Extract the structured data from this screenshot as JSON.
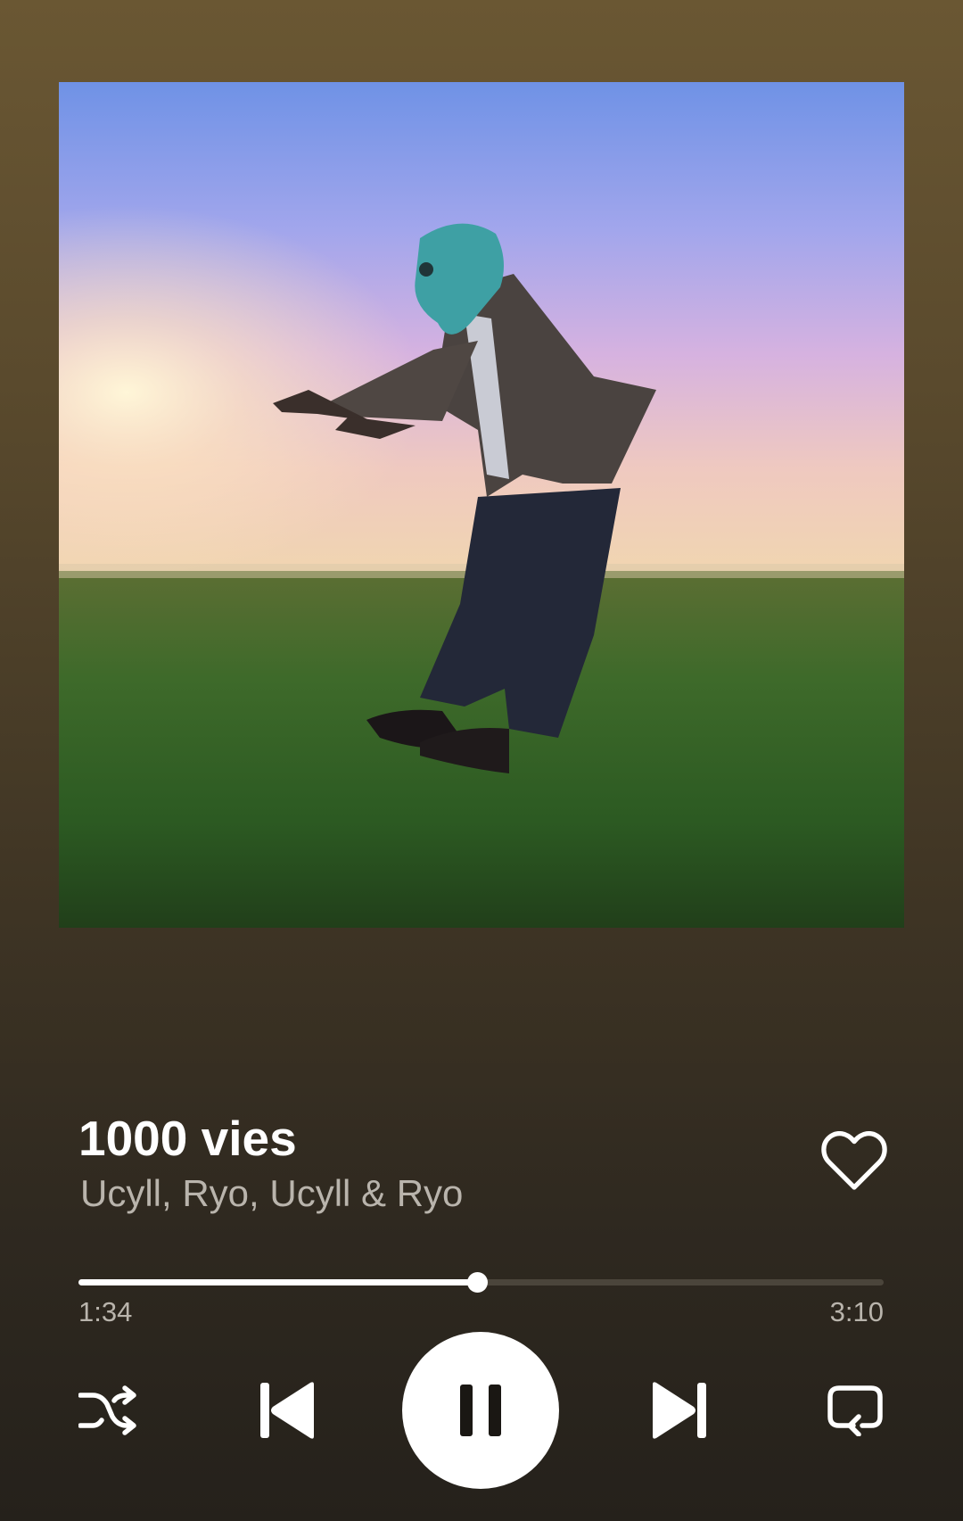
{
  "track": {
    "title": "1000 vies",
    "artists": "Ucyll, Ryo, Ucyll & Ryo"
  },
  "artwork": {
    "icon": "album-art"
  },
  "playback": {
    "elapsed": "1:34",
    "total": "3:10",
    "progress_fraction": 0.495,
    "state": "playing"
  },
  "controls": {
    "like_icon": "heart-outline-icon",
    "shuffle_icon": "shuffle-icon",
    "previous_icon": "skip-previous-icon",
    "pause_icon": "pause-icon",
    "next_icon": "skip-next-icon",
    "repeat_icon": "repeat-icon"
  },
  "colors": {
    "background_top": "#6a5733",
    "background_bottom": "#25211b",
    "text_primary": "#ffffff",
    "text_secondary": "#b9b4ac",
    "progress_track": "#4b453b",
    "progress_fill": "#ffffff"
  }
}
